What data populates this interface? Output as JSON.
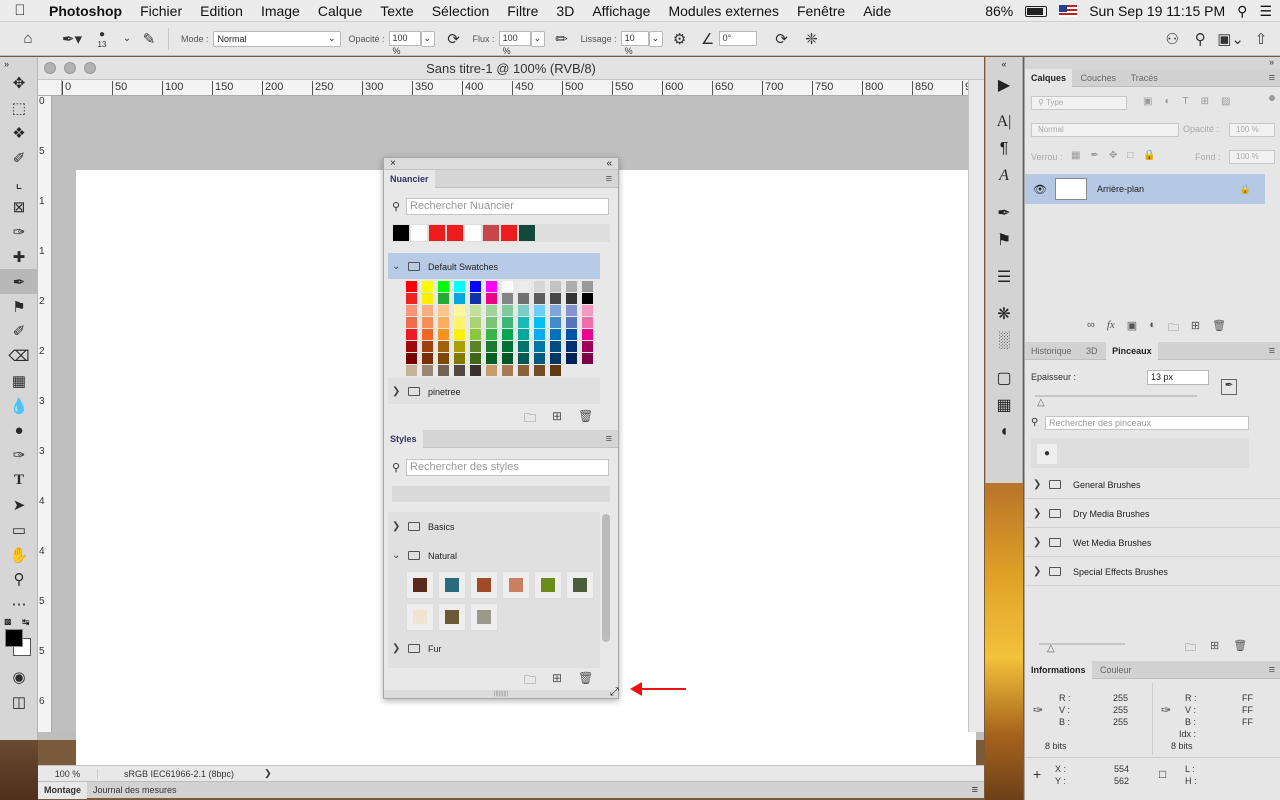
{
  "menubar": {
    "app_name": "Photoshop",
    "items": [
      "Fichier",
      "Edition",
      "Image",
      "Calque",
      "Texte",
      "Sélection",
      "Filtre",
      "3D",
      "Affichage",
      "Modules externes",
      "Fenêtre",
      "Aide"
    ],
    "battery": "86%",
    "datetime": "Sun Sep 19  11:15 PM"
  },
  "options": {
    "brush_size": "13",
    "mode_label": "Mode :",
    "mode_value": "Normal",
    "opacity_label": "Opacité :",
    "opacity_value": "100 %",
    "flow_label": "Flux :",
    "flow_value": "100 %",
    "smoothing_label": "Lissage :",
    "smoothing_value": "10 %",
    "angle_value": "0°"
  },
  "document": {
    "title": "Sans titre-1 @ 100% (RVB/8)",
    "zoom": "100 %",
    "color_profile": "sRGB IEC61966-2.1 (8bpc)",
    "ruler_h": [
      "0",
      "50",
      "100",
      "150",
      "200",
      "250",
      "300",
      "350",
      "400",
      "450",
      "500",
      "550",
      "600",
      "650",
      "700",
      "750",
      "800",
      "850",
      "9"
    ],
    "ruler_v": [
      "0",
      "5",
      "1",
      "1",
      "2",
      "2",
      "3",
      "3",
      "4",
      "4",
      "5",
      "5",
      "6"
    ],
    "bottom_tabs": [
      "Montage",
      "Journal des mesures"
    ]
  },
  "swatches_panel": {
    "tab": "Nuancier",
    "search_placeholder": "Rechercher Nuancier",
    "recent": [
      "#000000",
      "#ffffff",
      "#ee1c1c",
      "#ee1c1c",
      "#ffffff",
      "#c6464a",
      "#ee1c1c",
      "#0f4a3a"
    ],
    "default_group": "Default Swatches",
    "other_group": "pinetree",
    "grid_rows": [
      [
        "#ff0000",
        "#ffff00",
        "#00ff00",
        "#00ffff",
        "#0000ff",
        "#ff00ff",
        "#ffffff",
        "#ebebeb",
        "#d6d6d6",
        "#c2c2c2",
        "#adadad",
        "#999999"
      ],
      [
        "#ee2222",
        "#ffee00",
        "#22aa33",
        "#00aadd",
        "#1133aa",
        "#ee0088",
        "#858585",
        "#707070",
        "#5c5c5c",
        "#474747",
        "#333333",
        "#000000"
      ],
      [
        "#f7977a",
        "#f9ad81",
        "#fdc68a",
        "#fff79a",
        "#c4df9b",
        "#a2d39c",
        "#82ca9d",
        "#7bcdc8",
        "#6ecff6",
        "#7ea7d8",
        "#8493ca",
        "#f49ac2"
      ],
      [
        "#f26c4f",
        "#f68e55",
        "#fbaf5d",
        "#fff467",
        "#acd372",
        "#7cc576",
        "#3bb878",
        "#1abbb4",
        "#00bff3",
        "#438cca",
        "#5574b9",
        "#f06ea9"
      ],
      [
        "#ed1c24",
        "#f26522",
        "#f7941d",
        "#fff200",
        "#8dc73f",
        "#39b54a",
        "#00a651",
        "#00a99d",
        "#00aeef",
        "#0072bc",
        "#0054a6",
        "#ec008c"
      ],
      [
        "#9e0b0f",
        "#a0410d",
        "#a36209",
        "#aba000",
        "#598527",
        "#1a7b30",
        "#007236",
        "#00746b",
        "#0076a3",
        "#004b80",
        "#003471",
        "#9e005d"
      ],
      [
        "#790000",
        "#7b2e00",
        "#7d4900",
        "#827b00",
        "#406618",
        "#005e20",
        "#005826",
        "#005952",
        "#005b7f",
        "#003663",
        "#002157",
        "#7b0046"
      ],
      [
        "#c7b299",
        "#998675",
        "#736357",
        "#534741",
        "#37302d",
        "#c69c6d",
        "#a67c52",
        "#8c6239",
        "#754c24",
        "#603913"
      ]
    ],
    "footer_icons": [
      "new-group",
      "new-swatch",
      "delete"
    ]
  },
  "styles_panel": {
    "tab": "Styles",
    "search_placeholder": "Rechercher des styles",
    "groups": [
      "Basics",
      "Natural",
      "Fur"
    ],
    "natural_swatches": [
      "#5a2a1c",
      "#2a6a7a",
      "#a04a28",
      "#c88060",
      "#6a8a1a",
      "#4a5a3a",
      "#f0e4d0",
      "#6a5a3a",
      "#9a9a8a"
    ]
  },
  "layers_panel": {
    "tabs": [
      "Calques",
      "Couches",
      "Tracés"
    ],
    "filter_label": "Type",
    "blend": "Normal",
    "opacity_label": "Opacité :",
    "opacity_value": "100 %",
    "lock_label": "Verrou :",
    "fill_label": "Fond :",
    "fill_value": "100 %",
    "layer_name": "Arrière-plan"
  },
  "brushes_panel": {
    "tabs": [
      "Historique",
      "3D",
      "Pinceaux"
    ],
    "size_label": "Epaisseur :",
    "size_value": "13 px",
    "search_placeholder": "Rechercher des pinceaux",
    "groups": [
      "General Brushes",
      "Dry Media Brushes",
      "Wet Media Brushes",
      "Special Effects Brushes"
    ]
  },
  "info_panel": {
    "tabs": [
      "Informations",
      "Couleur"
    ],
    "rgb_labels": [
      "R :",
      "V :",
      "B :"
    ],
    "rgb_values": [
      "255",
      "255",
      "255"
    ],
    "hex_labels": [
      "R :",
      "V :",
      "B :",
      "Idx :"
    ],
    "hex_values": [
      "FF",
      "FF",
      "FF"
    ],
    "bits_left": "8 bits",
    "bits_right": "8 bits",
    "x_label": "X :",
    "y_label": "Y :",
    "x_value": "554",
    "y_value": "562",
    "l_label": "L :",
    "h_label": "H :"
  },
  "colors": {
    "accent": "#b7cbe6",
    "annotation_arrow": "#ee1111"
  }
}
